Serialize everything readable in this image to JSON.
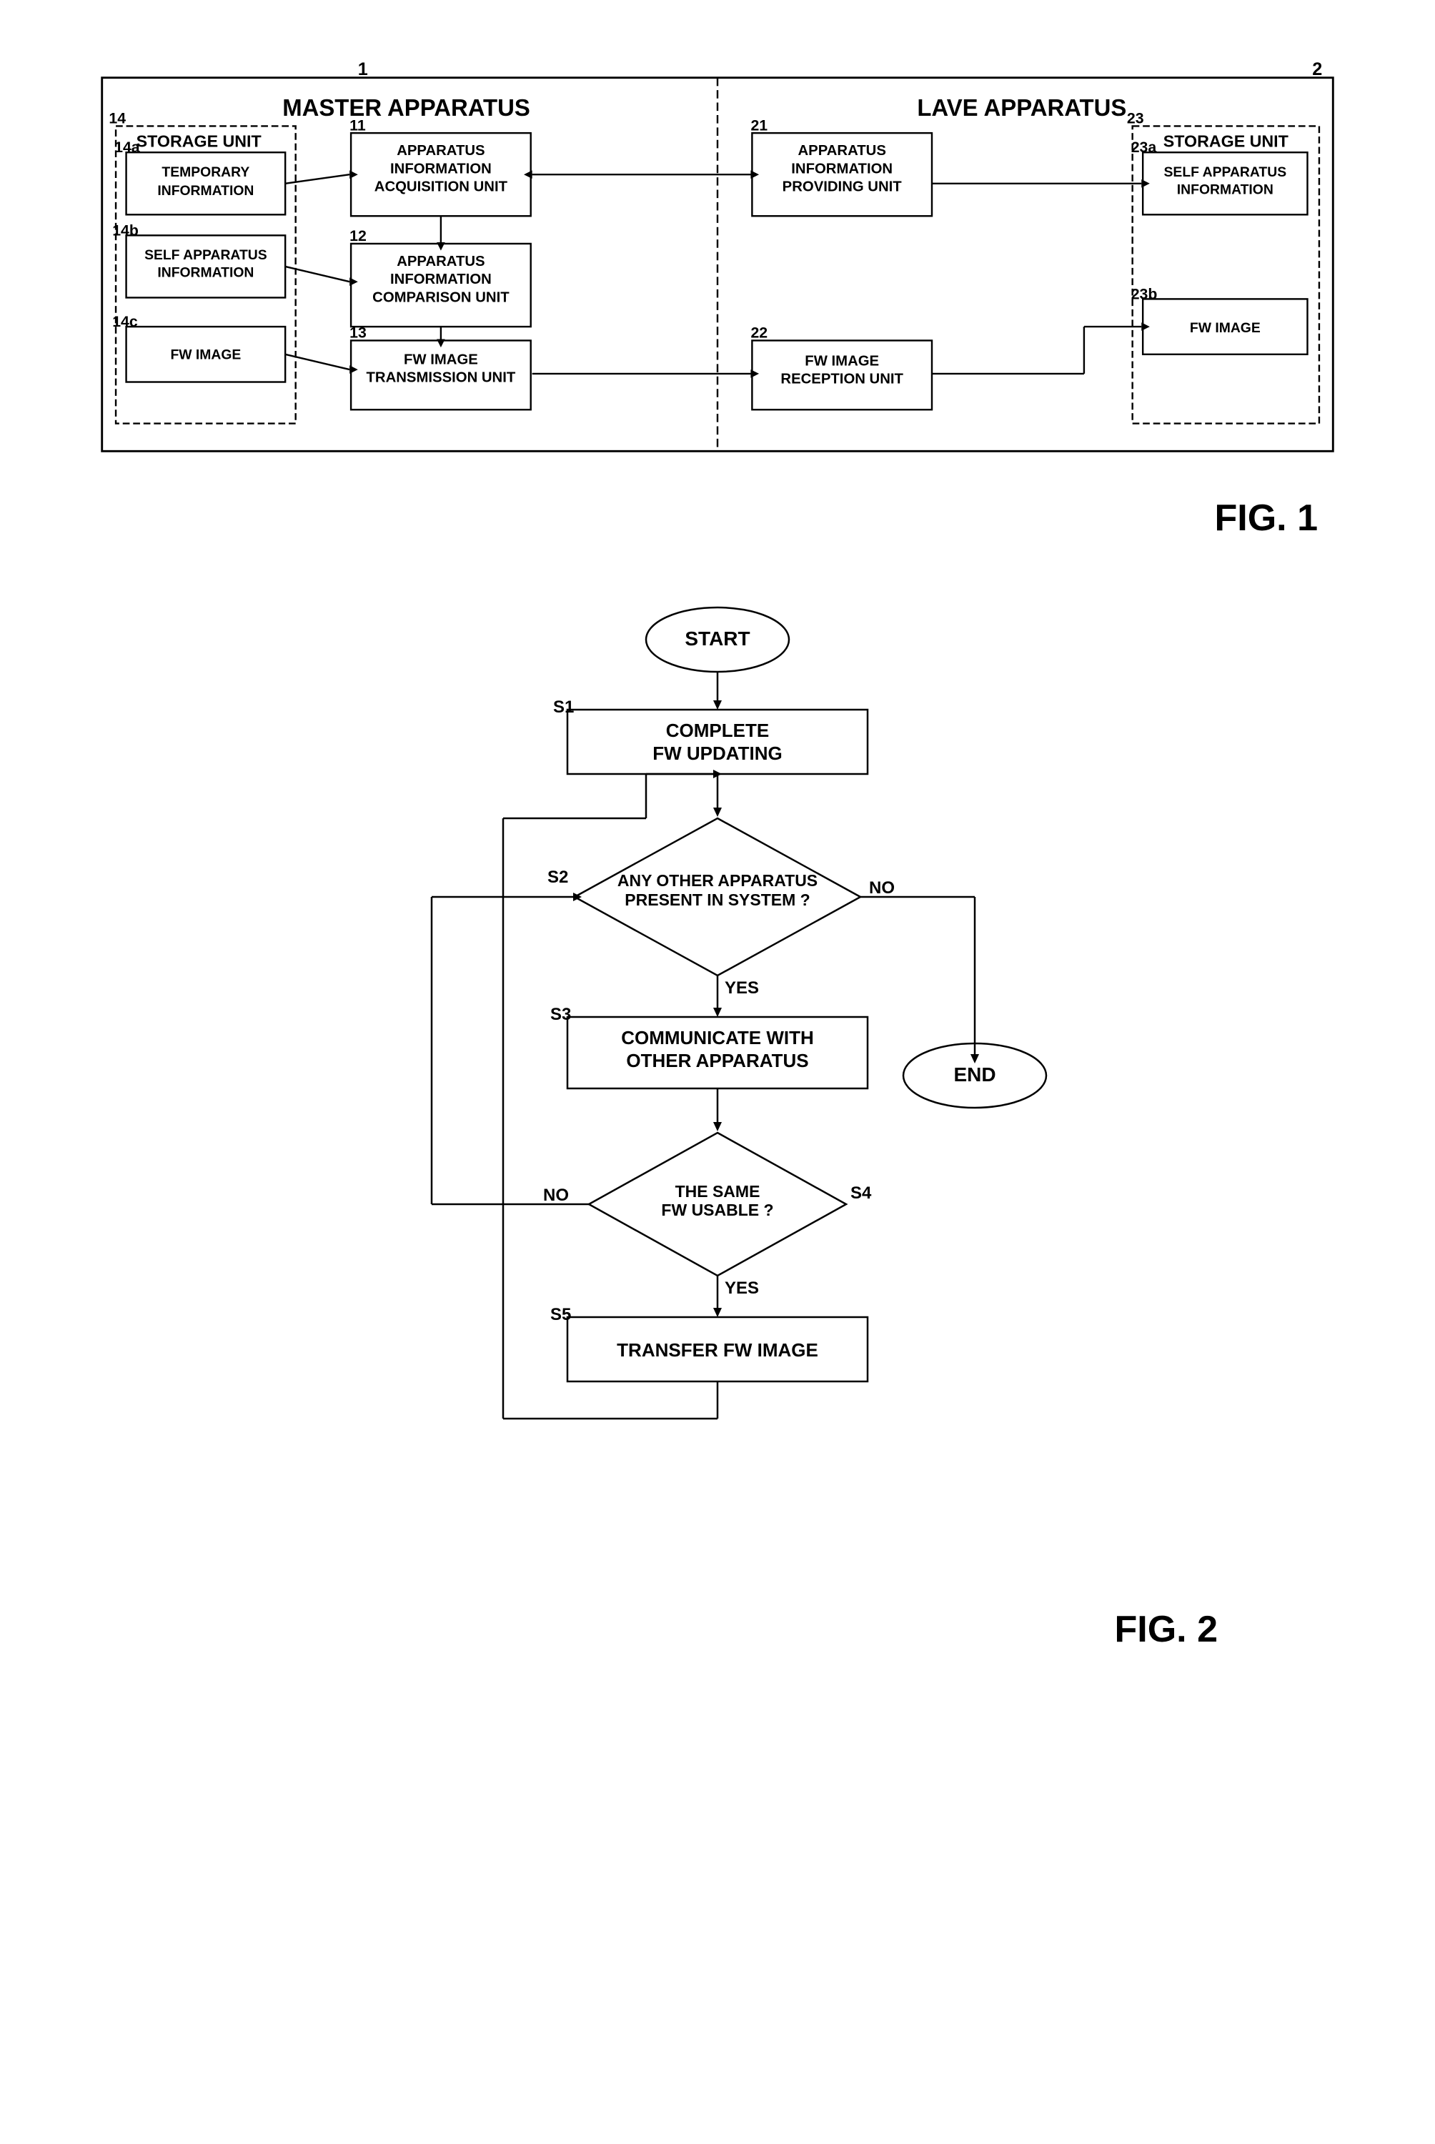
{
  "fig1": {
    "label": "FIG. 1",
    "corner1": "1",
    "corner2": "2",
    "master": {
      "title": "MASTER APPARATUS",
      "ref": "1",
      "storage_unit": {
        "label": "STORAGE UNIT",
        "ref": "14",
        "items": [
          {
            "ref": "14a",
            "label": "TEMPORARY\nINFORMATION"
          },
          {
            "ref": "14b",
            "label": "SELF APPARATUS\nINFORMATION"
          },
          {
            "ref": "14c",
            "label": "FW IMAGE"
          }
        ]
      },
      "units": [
        {
          "ref": "11",
          "label": "APPARATUS\nINFORMATION\nACQUISITION UNIT"
        },
        {
          "ref": "12",
          "label": "APPARATUS\nINFORMATION\nCOMPARISON UNIT"
        },
        {
          "ref": "13",
          "label": "FW IMAGE\nTRANSMISSION UNIT"
        }
      ]
    },
    "slave": {
      "title": "LAVE APPARATUS",
      "ref": "2",
      "storage_unit": {
        "label": "STORAGE UNIT",
        "ref": "23",
        "items": [
          {
            "ref": "23a",
            "label": "SELF APPARATUS\nINFORMATION"
          },
          {
            "ref": "23b",
            "label": "FW IMAGE"
          }
        ]
      },
      "units": [
        {
          "ref": "21",
          "label": "APPARATUS\nINFORMATION\nPROVIDING UNIT"
        },
        {
          "ref": "22",
          "label": "FW IMAGE\nRECEPTION UNIT"
        }
      ]
    }
  },
  "fig2": {
    "label": "FIG. 2",
    "nodes": {
      "start": "START",
      "end": "END",
      "s1": {
        "ref": "S1",
        "label": "COMPLETE\nFW UPDATING"
      },
      "s2": {
        "ref": "S2",
        "label": "ANY OTHER APPARATUS\nPRESENT IN SYSTEM ?",
        "yes": "YES",
        "no": "NO"
      },
      "s3": {
        "ref": "S3",
        "label": "COMMUNICATE WITH\nOTHER APPARATUS"
      },
      "s4": {
        "ref": "S4",
        "label": "THE SAME\nFW USABLE ?",
        "yes": "YES",
        "no": "NO"
      },
      "s5": {
        "ref": "S5",
        "label": "TRANSFER FW IMAGE"
      }
    }
  }
}
